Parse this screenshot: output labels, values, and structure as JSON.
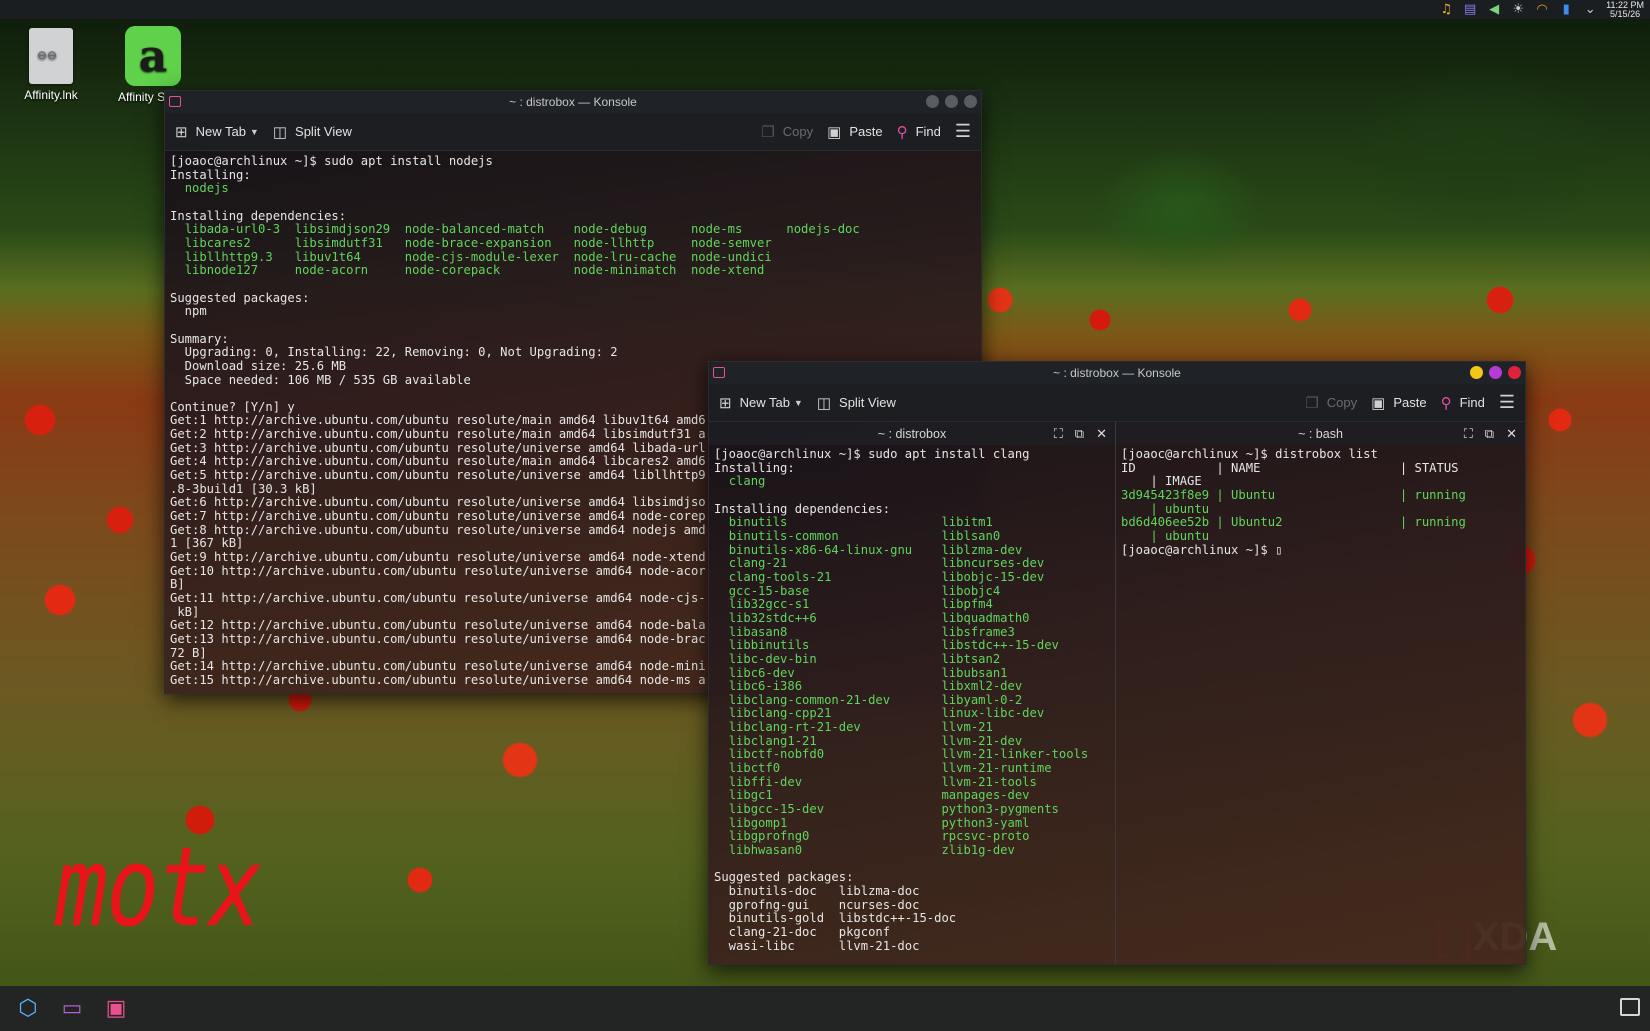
{
  "top_panel": {
    "time": "11:22 PM",
    "date": "5/15/26",
    "tray_icons": [
      "notification-bell-icon",
      "clipboard-icon",
      "volume-icon",
      "brightness-icon",
      "wifi-icon",
      "battery-icon",
      "chevron-down-icon"
    ]
  },
  "desktop": {
    "icons": [
      {
        "label": "Affinity.lnk"
      },
      {
        "label": "Affinity S"
      }
    ],
    "watermark": "motx",
    "xda_logo": "XDA"
  },
  "window1": {
    "title": "~ : distrobox — Konsole",
    "toolbar": {
      "new_tab": "New Tab",
      "split_view": "Split View",
      "copy": "Copy",
      "paste": "Paste",
      "find": "Find"
    },
    "lines": [
      [
        {
          "t": "[joaoc@archlinux ~]$ sudo apt install nodejs"
        }
      ],
      [
        {
          "t": "Installing:"
        }
      ],
      [
        {
          "t": "  "
        },
        {
          "t": "nodejs",
          "c": "g"
        }
      ],
      [
        {
          "t": ""
        }
      ],
      [
        {
          "t": "Installing dependencies:"
        }
      ],
      [
        {
          "t": "  "
        },
        {
          "t": "libada-url0-3  libsimdjson29  node-balanced-match    node-debug      node-ms      nodejs-doc",
          "c": "g"
        }
      ],
      [
        {
          "t": "  "
        },
        {
          "t": "libcares2      libsimdutf31   node-brace-expansion   node-llhttp     node-semver",
          "c": "g"
        }
      ],
      [
        {
          "t": "  "
        },
        {
          "t": "libllhttp9.3   libuv1t64      node-cjs-module-lexer  node-lru-cache  node-undici",
          "c": "g"
        }
      ],
      [
        {
          "t": "  "
        },
        {
          "t": "libnode127     node-acorn     node-corepack          node-minimatch  node-xtend",
          "c": "g"
        }
      ],
      [
        {
          "t": ""
        }
      ],
      [
        {
          "t": "Suggested packages:"
        }
      ],
      [
        {
          "t": "  npm"
        }
      ],
      [
        {
          "t": ""
        }
      ],
      [
        {
          "t": "Summary:"
        }
      ],
      [
        {
          "t": "  Upgrading: 0, Installing: 22, Removing: 0, Not Upgrading: 2"
        }
      ],
      [
        {
          "t": "  Download size: 25.6 MB"
        }
      ],
      [
        {
          "t": "  Space needed: 106 MB / 535 GB available"
        }
      ],
      [
        {
          "t": ""
        }
      ],
      [
        {
          "t": "Continue? [Y/n] y"
        }
      ],
      [
        {
          "t": "Get:1 http://archive.ubuntu.com/ubuntu resolute/main amd64 libuv1t64 amd6"
        }
      ],
      [
        {
          "t": "Get:2 http://archive.ubuntu.com/ubuntu resolute/main amd64 libsimdutf31 a"
        }
      ],
      [
        {
          "t": "Get:3 http://archive.ubuntu.com/ubuntu resolute/universe amd64 libada-url"
        }
      ],
      [
        {
          "t": "Get:4 http://archive.ubuntu.com/ubuntu resolute/main amd64 libcares2 amd6"
        }
      ],
      [
        {
          "t": "Get:5 http://archive.ubuntu.com/ubuntu resolute/universe amd64 libllhttp9"
        }
      ],
      [
        {
          "t": ".8-3build1 [30.3 kB]"
        }
      ],
      [
        {
          "t": "Get:6 http://archive.ubuntu.com/ubuntu resolute/universe amd64 libsimdjso"
        }
      ],
      [
        {
          "t": "Get:7 http://archive.ubuntu.com/ubuntu resolute/universe amd64 node-corep"
        }
      ],
      [
        {
          "t": "Get:8 http://archive.ubuntu.com/ubuntu resolute/universe amd64 nodejs amd"
        }
      ],
      [
        {
          "t": "1 [367 kB]"
        }
      ],
      [
        {
          "t": "Get:9 http://archive.ubuntu.com/ubuntu resolute/universe amd64 node-xtend"
        }
      ],
      [
        {
          "t": "Get:10 http://archive.ubuntu.com/ubuntu resolute/universe amd64 node-acor"
        }
      ],
      [
        {
          "t": "B]"
        }
      ],
      [
        {
          "t": "Get:11 http://archive.ubuntu.com/ubuntu resolute/universe amd64 node-cjs-"
        }
      ],
      [
        {
          "t": " kB]"
        }
      ],
      [
        {
          "t": "Get:12 http://archive.ubuntu.com/ubuntu resolute/universe amd64 node-bala"
        }
      ],
      [
        {
          "t": "Get:13 http://archive.ubuntu.com/ubuntu resolute/universe amd64 node-brac"
        }
      ],
      [
        {
          "t": "72 B]"
        }
      ],
      [
        {
          "t": "Get:14 http://archive.ubuntu.com/ubuntu resolute/universe amd64 node-mini"
        }
      ],
      [
        {
          "t": "Get:15 http://archive.ubuntu.com/ubuntu resolute/universe amd64 node-ms a"
        }
      ]
    ]
  },
  "window2": {
    "title": "~ : distrobox — Konsole",
    "toolbar": {
      "new_tab": "New Tab",
      "split_view": "Split View",
      "copy": "Copy",
      "paste": "Paste",
      "find": "Find"
    },
    "left_pane": {
      "title": "~ : distrobox",
      "lines": [
        [
          {
            "t": "[joaoc@archlinux ~]$ sudo apt install clang"
          }
        ],
        [
          {
            "t": "Installing:"
          }
        ],
        [
          {
            "t": "  "
          },
          {
            "t": "clang",
            "c": "g"
          }
        ],
        [
          {
            "t": ""
          }
        ],
        [
          {
            "t": "Installing dependencies:"
          }
        ],
        [
          {
            "t": "  "
          },
          {
            "t": "binutils                     libitm1",
            "c": "g"
          }
        ],
        [
          {
            "t": "  "
          },
          {
            "t": "binutils-common              liblsan0",
            "c": "g"
          }
        ],
        [
          {
            "t": "  "
          },
          {
            "t": "binutils-x86-64-linux-gnu    liblzma-dev",
            "c": "g"
          }
        ],
        [
          {
            "t": "  "
          },
          {
            "t": "clang-21                     libncurses-dev",
            "c": "g"
          }
        ],
        [
          {
            "t": "  "
          },
          {
            "t": "clang-tools-21               libobjc-15-dev",
            "c": "g"
          }
        ],
        [
          {
            "t": "  "
          },
          {
            "t": "gcc-15-base                  libobjc4",
            "c": "g"
          }
        ],
        [
          {
            "t": "  "
          },
          {
            "t": "lib32gcc-s1                  libpfm4",
            "c": "g"
          }
        ],
        [
          {
            "t": "  "
          },
          {
            "t": "lib32stdc++6                 libquadmath0",
            "c": "g"
          }
        ],
        [
          {
            "t": "  "
          },
          {
            "t": "libasan8                     libsframe3",
            "c": "g"
          }
        ],
        [
          {
            "t": "  "
          },
          {
            "t": "libbinutils                  libstdc++-15-dev",
            "c": "g"
          }
        ],
        [
          {
            "t": "  "
          },
          {
            "t": "libc-dev-bin                 libtsan2",
            "c": "g"
          }
        ],
        [
          {
            "t": "  "
          },
          {
            "t": "libc6-dev                    libubsan1",
            "c": "g"
          }
        ],
        [
          {
            "t": "  "
          },
          {
            "t": "libc6-i386                   libxml2-dev",
            "c": "g"
          }
        ],
        [
          {
            "t": "  "
          },
          {
            "t": "libclang-common-21-dev       libyaml-0-2",
            "c": "g"
          }
        ],
        [
          {
            "t": "  "
          },
          {
            "t": "libclang-cpp21               linux-libc-dev",
            "c": "g"
          }
        ],
        [
          {
            "t": "  "
          },
          {
            "t": "libclang-rt-21-dev           llvm-21",
            "c": "g"
          }
        ],
        [
          {
            "t": "  "
          },
          {
            "t": "libclang1-21                 llvm-21-dev",
            "c": "g"
          }
        ],
        [
          {
            "t": "  "
          },
          {
            "t": "libctf-nobfd0                llvm-21-linker-tools",
            "c": "g"
          }
        ],
        [
          {
            "t": "  "
          },
          {
            "t": "libctf0                      llvm-21-runtime",
            "c": "g"
          }
        ],
        [
          {
            "t": "  "
          },
          {
            "t": "libffi-dev                   llvm-21-tools",
            "c": "g"
          }
        ],
        [
          {
            "t": "  "
          },
          {
            "t": "libgc1                       manpages-dev",
            "c": "g"
          }
        ],
        [
          {
            "t": "  "
          },
          {
            "t": "libgcc-15-dev                python3-pygments",
            "c": "g"
          }
        ],
        [
          {
            "t": "  "
          },
          {
            "t": "libgomp1                     python3-yaml",
            "c": "g"
          }
        ],
        [
          {
            "t": "  "
          },
          {
            "t": "libgprofng0                  rpcsvc-proto",
            "c": "g"
          }
        ],
        [
          {
            "t": "  "
          },
          {
            "t": "libhwasan0                   zlib1g-dev",
            "c": "g"
          }
        ],
        [
          {
            "t": ""
          }
        ],
        [
          {
            "t": "Suggested packages:"
          }
        ],
        [
          {
            "t": "  binutils-doc   liblzma-doc"
          }
        ],
        [
          {
            "t": "  gprofng-gui    ncurses-doc"
          }
        ],
        [
          {
            "t": "  binutils-gold  libstdc++-15-doc"
          }
        ],
        [
          {
            "t": "  clang-21-doc   pkgconf"
          }
        ],
        [
          {
            "t": "  wasi-libc      llvm-21-doc"
          }
        ]
      ]
    },
    "right_pane": {
      "title": "~ : bash",
      "lines": [
        [
          {
            "t": "[joaoc@archlinux ~]$ distrobox list"
          }
        ],
        [
          {
            "t": "ID           | NAME                   | STATUS"
          }
        ],
        [
          {
            "t": "    | IMAGE"
          }
        ],
        [
          {
            "t": "3d945423f8e9 | Ubuntu                 | running",
            "c": "g"
          }
        ],
        [
          {
            "t": "    | ubuntu",
            "c": "g"
          }
        ],
        [
          {
            "t": "bd6d406ee52b | Ubuntu2                | running",
            "c": "g"
          }
        ],
        [
          {
            "t": "    | ubuntu",
            "c": "g"
          }
        ],
        [
          {
            "t": "[joaoc@archlinux ~]$ "
          },
          {
            "t": "▯"
          }
        ]
      ]
    }
  }
}
